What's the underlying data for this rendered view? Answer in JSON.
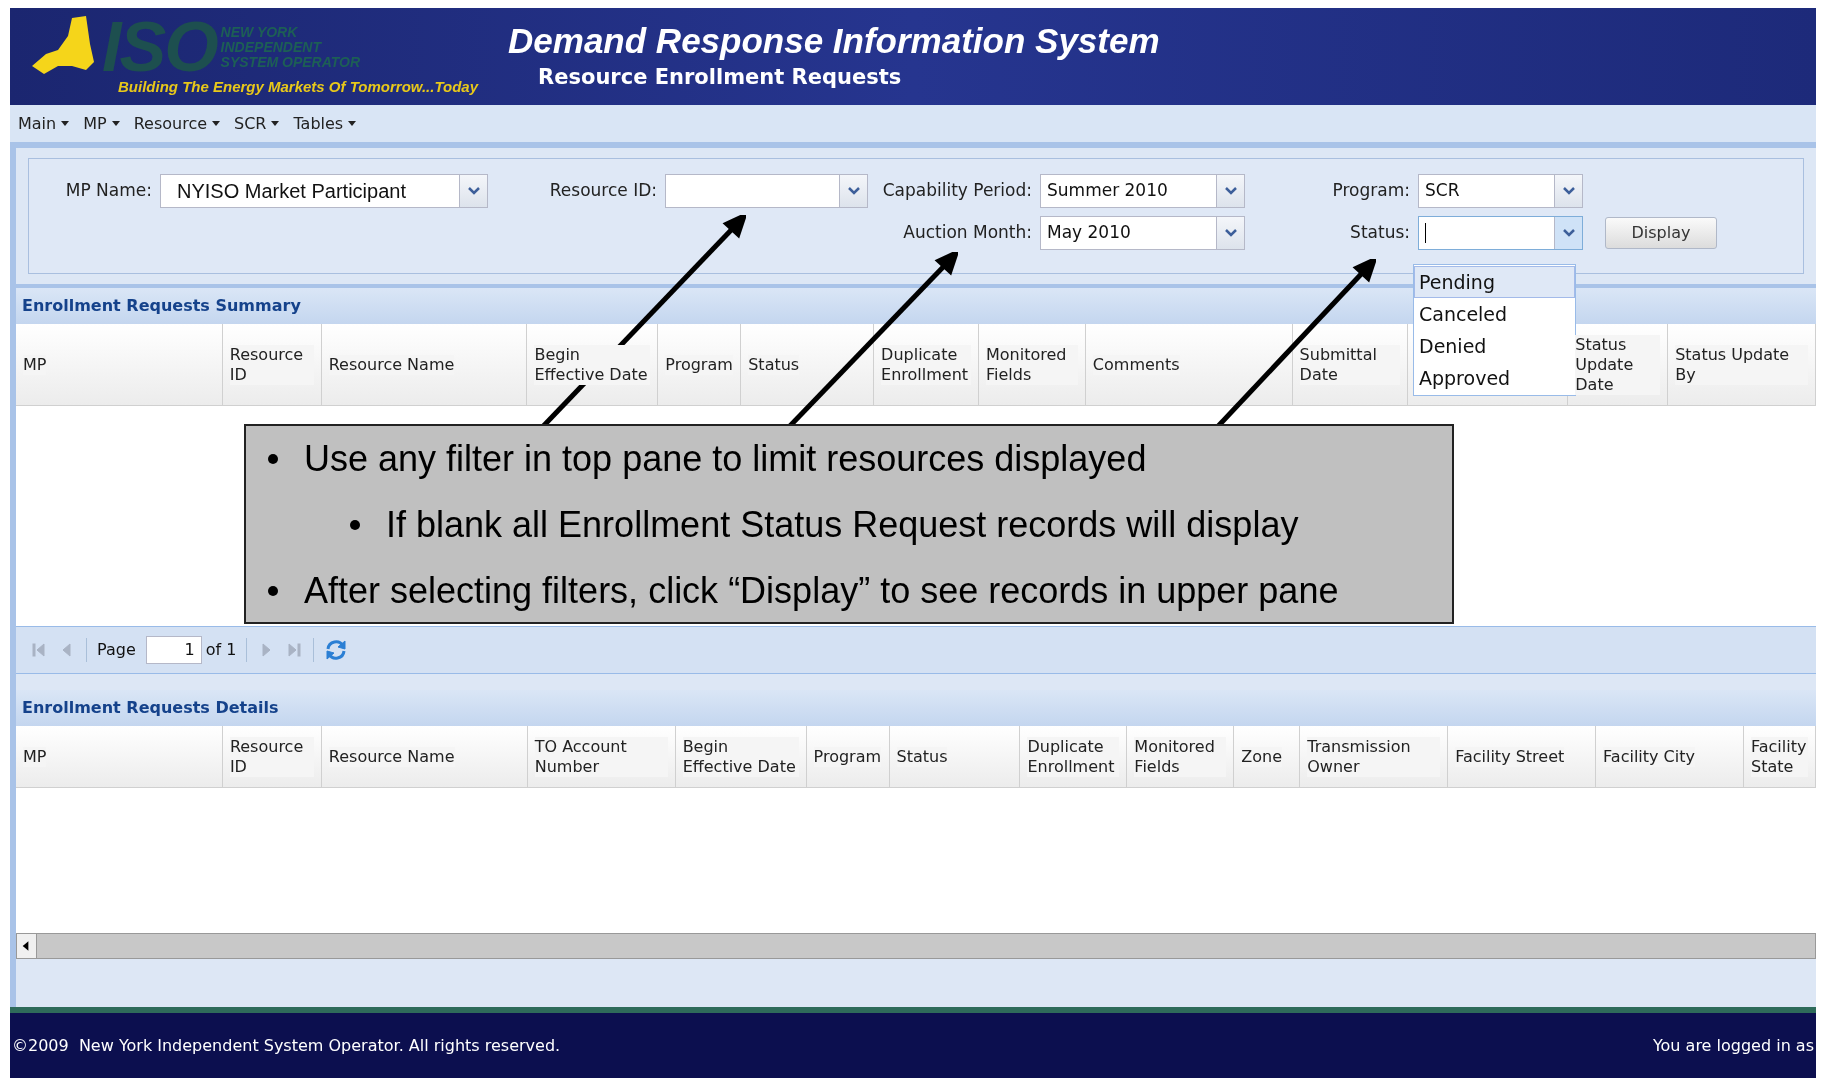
{
  "header": {
    "logo": {
      "mark": "ISO",
      "lines": [
        "NEW YORK",
        "INDEPENDENT",
        "SYSTEM OPERATOR"
      ],
      "tagline": "Building The Energy Markets Of Tomorrow...Today"
    },
    "title": "Demand Response Information System",
    "subtitle": "Resource Enrollment Requests"
  },
  "menu": [
    {
      "label": "Main"
    },
    {
      "label": "MP"
    },
    {
      "label": "Resource"
    },
    {
      "label": "SCR"
    },
    {
      "label": "Tables"
    }
  ],
  "filters": [
    {
      "label": "MP Name:",
      "value": "NYISO Market Participant",
      "focused": false
    },
    {
      "label": "Resource ID:",
      "focused": false
    },
    {
      "label": "Capability Period:",
      "value": "Summer 2010",
      "focused": false
    },
    {
      "label": "Program:",
      "value": "SCR",
      "focused": false
    },
    {
      "label": "Auction Month:",
      "value": "May 2010",
      "focused": false
    },
    {
      "label": "Status:",
      "focused": true
    }
  ],
  "display_button": "Display",
  "status_options": [
    {
      "label": "Pending",
      "selected": true
    },
    {
      "label": "Canceled",
      "selected": false
    },
    {
      "label": "Denied",
      "selected": false
    },
    {
      "label": "Approved",
      "selected": false
    }
  ],
  "summary": {
    "title": "Enrollment Requests Summary",
    "columns": [
      "MP",
      "Resource ID",
      "Resource Name",
      "Begin Effective Date",
      "Program",
      "Status",
      "Duplicate Enrollment",
      "Monitored Fields",
      "Comments",
      "Submittal Date",
      "Status Update Date",
      "Status Update By"
    ]
  },
  "pager": {
    "buttons": [
      {
        "kind": "first",
        "disabled": true
      },
      {
        "kind": "prev",
        "disabled": true
      },
      {
        "kind": "next",
        "disabled": true
      },
      {
        "kind": "last",
        "disabled": true
      },
      {
        "kind": "refresh",
        "disabled": false
      }
    ],
    "label": "Page",
    "value": "1",
    "total": "of 1"
  },
  "details": {
    "title": "Enrollment Requests Details",
    "columns": [
      "MP",
      "Resource ID",
      "Resource Name",
      "TO Account Number",
      "Begin Effective Date",
      "Program",
      "Status",
      "Duplicate Enrollment",
      "Monitored Fields",
      "Zone",
      "Transmission Owner",
      "Facility Street",
      "Facility City",
      "Facility State"
    ]
  },
  "callout": {
    "items": [
      {
        "text": "Use any filter in top pane to limit resources displayed",
        "children": [
          {
            "text": "If blank all Enrollment Status Request records will display"
          }
        ]
      },
      {
        "text": "After selecting filters, click “Display” to see records in upper pane"
      }
    ]
  },
  "footer": {
    "copyright": "©2009  New York Independent System Operator. All rights reserved.",
    "login": "You are logged in as"
  }
}
